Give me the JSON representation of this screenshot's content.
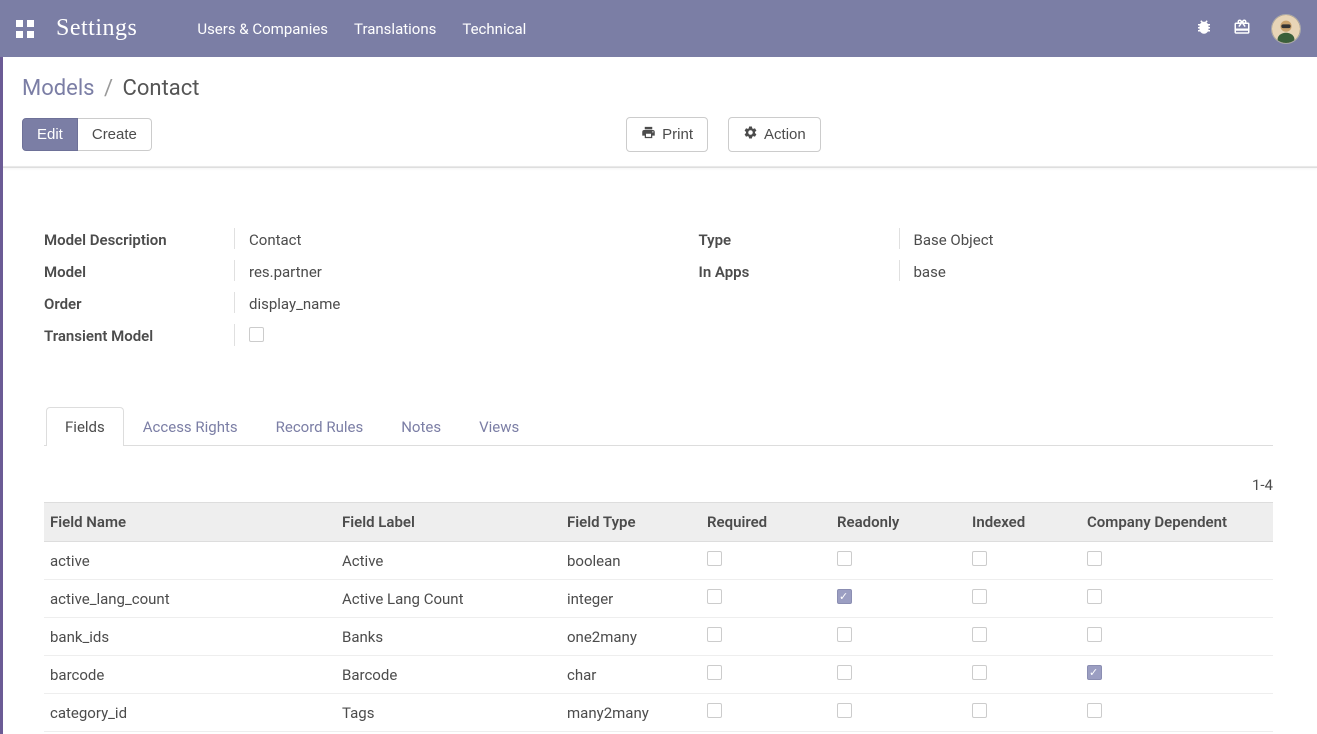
{
  "header": {
    "title": "Settings",
    "menu": [
      "Users & Companies",
      "Translations",
      "Technical"
    ]
  },
  "breadcrumb": {
    "parent": "Models",
    "current": "Contact"
  },
  "toolbar": {
    "edit": "Edit",
    "create": "Create",
    "print": "Print",
    "action": "Action"
  },
  "form": {
    "left": {
      "model_description_label": "Model Description",
      "model_description_value": "Contact",
      "model_label": "Model",
      "model_value": "res.partner",
      "order_label": "Order",
      "order_value": "display_name",
      "transient_label": "Transient Model",
      "transient_checked": false
    },
    "right": {
      "type_label": "Type",
      "type_value": "Base Object",
      "in_apps_label": "In Apps",
      "in_apps_value": "base"
    }
  },
  "tabs": [
    "Fields",
    "Access Rights",
    "Record Rules",
    "Notes",
    "Views"
  ],
  "pager": "1-4",
  "table": {
    "columns": [
      "Field Name",
      "Field Label",
      "Field Type",
      "Required",
      "Readonly",
      "Indexed",
      "Company Dependent"
    ],
    "rows": [
      {
        "name": "active",
        "label": "Active",
        "type": "boolean",
        "required": false,
        "readonly": false,
        "indexed": false,
        "company_dependant": false
      },
      {
        "name": "active_lang_count",
        "label": "Active Lang Count",
        "type": "integer",
        "required": false,
        "readonly": true,
        "indexed": false,
        "company_dependant": false
      },
      {
        "name": "bank_ids",
        "label": "Banks",
        "type": "one2many",
        "required": false,
        "readonly": false,
        "indexed": false,
        "company_dependant": false
      },
      {
        "name": "barcode",
        "label": "Barcode",
        "type": "char",
        "required": false,
        "readonly": false,
        "indexed": false,
        "company_dependant": true
      },
      {
        "name": "category_id",
        "label": "Tags",
        "type": "many2many",
        "required": false,
        "readonly": false,
        "indexed": false,
        "company_dependant": false
      }
    ]
  }
}
